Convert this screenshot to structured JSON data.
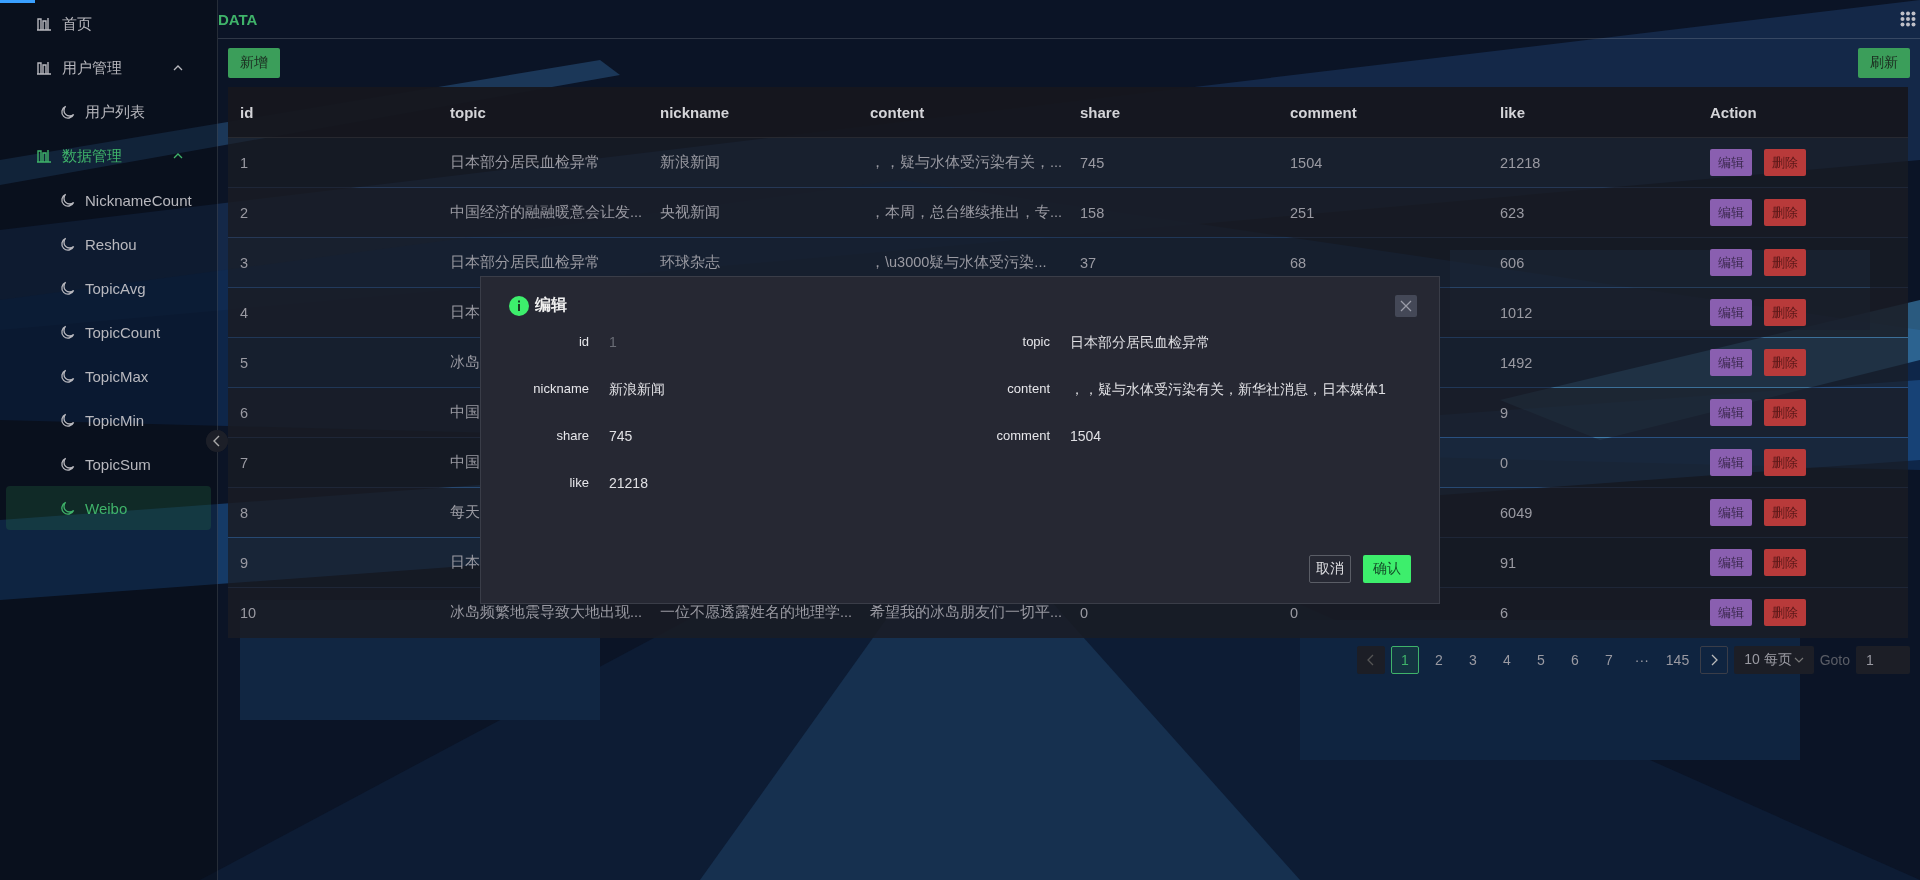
{
  "sidebar": {
    "items": [
      {
        "label": "首页",
        "selected": false
      },
      {
        "label": "用户管理",
        "selected": false,
        "active": false,
        "expanded": true,
        "children": [
          {
            "label": "用户列表",
            "selected": false
          }
        ]
      },
      {
        "label": "数据管理",
        "selected": false,
        "active": true,
        "expanded": true,
        "children": [
          {
            "label": "NicknameCount",
            "selected": false
          },
          {
            "label": "Reshou",
            "selected": false
          },
          {
            "label": "TopicAvg",
            "selected": false
          },
          {
            "label": "TopicCount",
            "selected": false
          },
          {
            "label": "TopicMax",
            "selected": false
          },
          {
            "label": "TopicMin",
            "selected": false
          },
          {
            "label": "TopicSum",
            "selected": false
          },
          {
            "label": "Weibo",
            "selected": true
          }
        ]
      }
    ]
  },
  "progress": {
    "level": 0.018
  },
  "header": {
    "title": "DATA"
  },
  "toolbar": {
    "add": "新增",
    "refresh": "刷新"
  },
  "table": {
    "columns": [
      "id",
      "topic",
      "nickname",
      "content",
      "share",
      "comment",
      "like",
      "Action"
    ],
    "rows": [
      {
        "id": "1",
        "topic": "日本部分居民血检异常",
        "nickname": "新浪新闻",
        "content": "，，疑与水体受污染有关，...",
        "share": "745",
        "comment": "1504",
        "like": "21218",
        "actions": [
          {
            "label": "编辑",
            "kind": "edit"
          },
          {
            "label": "删除",
            "kind": "delete"
          }
        ]
      },
      {
        "id": "2",
        "topic": "中国经济的融融暖意会让发...",
        "nickname": "央视新闻",
        "content": "，本周，总台继续推出，专...",
        "share": "158",
        "comment": "251",
        "like": "623",
        "actions": [
          {
            "label": "编辑",
            "kind": "edit"
          },
          {
            "label": "删除",
            "kind": "delete"
          }
        ]
      },
      {
        "id": "3",
        "topic": "日本部分居民血检异常",
        "nickname": "环球杂志",
        "content": "，\\u3000疑与水体受污染...",
        "share": "37",
        "comment": "68",
        "like": "606",
        "actions": [
          {
            "label": "编辑",
            "kind": "edit"
          },
          {
            "label": "删除",
            "kind": "delete"
          }
        ]
      },
      {
        "id": "4",
        "topic": "日本",
        "like": "1012",
        "actions": [
          {
            "label": "编辑",
            "kind": "edit"
          },
          {
            "label": "删除",
            "kind": "delete"
          }
        ]
      },
      {
        "id": "5",
        "topic": "冰岛",
        "like": "1492",
        "actions": [
          {
            "label": "编辑",
            "kind": "edit"
          },
          {
            "label": "删除",
            "kind": "delete"
          }
        ]
      },
      {
        "id": "6",
        "topic": "中国",
        "like": "9",
        "actions": [
          {
            "label": "编辑",
            "kind": "edit"
          },
          {
            "label": "删除",
            "kind": "delete"
          }
        ]
      },
      {
        "id": "7",
        "topic": "中国",
        "like": "0",
        "actions": [
          {
            "label": "编辑",
            "kind": "edit"
          },
          {
            "label": "删除",
            "kind": "delete"
          }
        ]
      },
      {
        "id": "8",
        "topic": "每天",
        "like": "6049",
        "actions": [
          {
            "label": "编辑",
            "kind": "edit"
          },
          {
            "label": "删除",
            "kind": "delete"
          }
        ]
      },
      {
        "id": "9",
        "topic": "日本",
        "like": "91",
        "actions": [
          {
            "label": "编辑",
            "kind": "edit"
          },
          {
            "label": "删除",
            "kind": "delete"
          }
        ]
      },
      {
        "id": "10",
        "topic": "冰岛频繁地震导致大地出现...",
        "nickname": "一位不愿透露姓名的地理学...",
        "content": "希望我的冰岛朋友们一切平...",
        "share": "0",
        "comment": "0",
        "like": "6",
        "actions": [
          {
            "label": "编辑",
            "kind": "edit"
          },
          {
            "label": "删除",
            "kind": "delete"
          }
        ]
      }
    ]
  },
  "pagination": {
    "prev_disabled": true,
    "pages": [
      {
        "label": "1",
        "selected": true
      },
      {
        "label": "2",
        "selected": false
      },
      {
        "label": "3",
        "selected": false
      },
      {
        "label": "4",
        "selected": false
      },
      {
        "label": "5",
        "selected": false
      },
      {
        "label": "6",
        "selected": false
      },
      {
        "label": "7",
        "selected": false
      }
    ],
    "ellipsis": "···",
    "last_page": {
      "label": "145",
      "selected": false
    },
    "page_size": "10 每页",
    "goto_label": "Goto",
    "goto_value": "1"
  },
  "dialog": {
    "title": "编辑",
    "fields": [
      {
        "label": "id",
        "value": "1",
        "disabled": true
      },
      {
        "label": "topic",
        "value": "日本部分居民血检异常",
        "disabled": false
      },
      {
        "label": "nickname",
        "value": "新浪新闻",
        "disabled": false
      },
      {
        "label": "content",
        "value": "，，疑与水体受污染有关，新华社消息，日本媒体1",
        "disabled": false
      },
      {
        "label": "share",
        "value": "745",
        "disabled": false
      },
      {
        "label": "comment",
        "value": "1504",
        "disabled": false
      },
      {
        "label": "like",
        "value": "21218",
        "disabled": false
      }
    ],
    "cancel": "取消",
    "confirm": "确认"
  }
}
